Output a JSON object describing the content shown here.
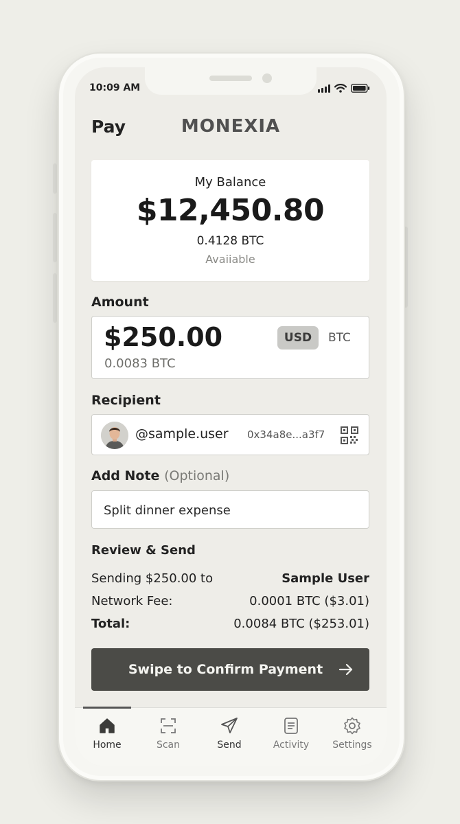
{
  "status_bar": {
    "time": "10:09 AM"
  },
  "header": {
    "title": "Pay",
    "brand": "MONEXIA"
  },
  "balance": {
    "label": "My Balance",
    "amount": "$12,450.80",
    "btc": "0.4128 BTC",
    "available": "Avaiiable"
  },
  "amount": {
    "label": "Amount",
    "value": "$250.00",
    "btc_equivalent": "0.0083 BTC",
    "currency_options": [
      "USD",
      "BTC"
    ],
    "selected_currency": "USD"
  },
  "recipient": {
    "label": "Recipient",
    "username": "@sample.user",
    "address": "0x34a8e...a3f7"
  },
  "note": {
    "label": "Add Note",
    "optional_label": "(Optional)",
    "value": "Split dinner expense"
  },
  "review": {
    "title": "Review & Send",
    "sending_label": "Sending $250.00 to",
    "recipient_name": "Sample User",
    "fee_label": "Network Fee:",
    "fee_value": "0.0001 BTC ($3.01)",
    "total_label": "Total:",
    "total_value": "0.0084 BTC ($253.01)"
  },
  "confirm": {
    "label": "Swipe to Confirm Payment"
  },
  "tabbar": {
    "items": [
      {
        "label": "Home",
        "icon": "home-icon"
      },
      {
        "label": "Scan",
        "icon": "scan-icon"
      },
      {
        "label": "Send",
        "icon": "send-icon"
      },
      {
        "label": "Activity",
        "icon": "activity-icon"
      },
      {
        "label": "Settings",
        "icon": "settings-icon"
      }
    ],
    "active": "Home"
  },
  "colors": {
    "background": "#eeede8",
    "card": "#ffffff",
    "button": "#4b4b47",
    "text": "#1c1c1c"
  }
}
